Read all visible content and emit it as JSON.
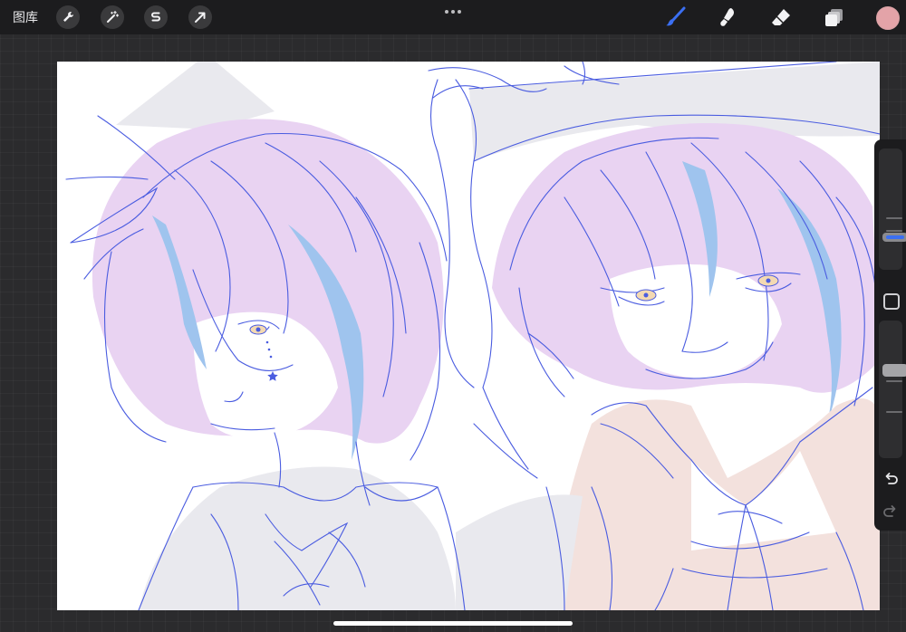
{
  "toolbar": {
    "gallery_label": "图库",
    "left_tools": [
      {
        "icon": "wrench-icon",
        "label": ""
      },
      {
        "icon": "magic-wand-icon",
        "label": ""
      },
      {
        "icon": "selection-s-icon",
        "label": ""
      },
      {
        "icon": "transform-arrow-icon",
        "label": ""
      }
    ],
    "more_icon": "more-dots-icon",
    "right_tools": [
      {
        "icon": "brush-icon",
        "active": true
      },
      {
        "icon": "smudge-icon",
        "active": false
      },
      {
        "icon": "eraser-icon",
        "active": false
      },
      {
        "icon": "layers-icon",
        "active": false
      }
    ],
    "current_color": "#e3a3a8",
    "active_tool_color": "#3b6ff2"
  },
  "sidebar": {
    "brush_size_percent": 25,
    "brush_opacity_percent": 35,
    "modify_icon": "square-modify-icon",
    "undo_icon": "undo-icon",
    "redo_icon": "redo-icon"
  },
  "canvas": {
    "line_color": "#4a5ce0",
    "hair_color": "#e9d3f2",
    "highlight_color": "#9fc4ee",
    "shadow_color": "#e9e9ee",
    "coat_color": "#f3e1dd"
  }
}
